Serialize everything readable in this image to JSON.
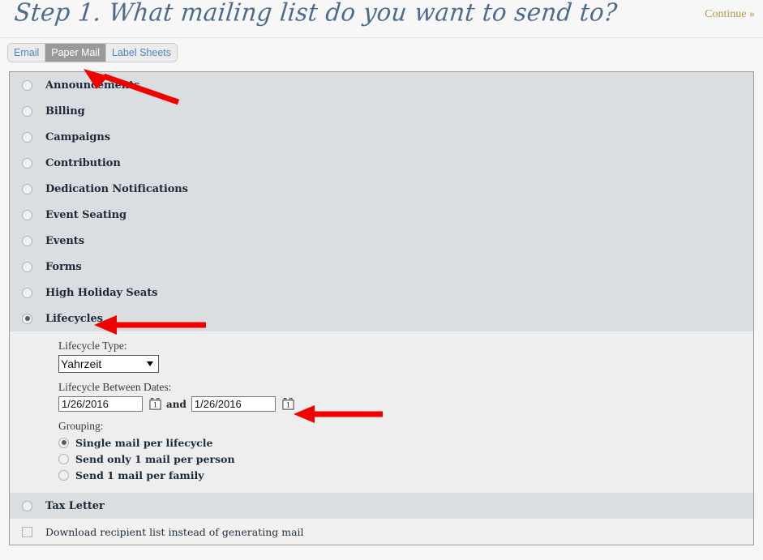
{
  "header": {
    "title": "Step 1. What mailing list do you want to send to?",
    "continue_label": "Continue »",
    "title_color": "#4d6b8f",
    "continue_color": "#b39841"
  },
  "tabs": [
    {
      "label": "Email",
      "active": false
    },
    {
      "label": "Paper Mail",
      "active": true
    },
    {
      "label": "Label Sheets",
      "active": false
    }
  ],
  "list": {
    "items": [
      {
        "label": "Announcements",
        "selected": false
      },
      {
        "label": "Billing",
        "selected": false
      },
      {
        "label": "Campaigns",
        "selected": false
      },
      {
        "label": "Contribution",
        "selected": false
      },
      {
        "label": "Dedication Notifications",
        "selected": false
      },
      {
        "label": "Event Seating",
        "selected": false
      },
      {
        "label": "Events",
        "selected": false
      },
      {
        "label": "Forms",
        "selected": false
      },
      {
        "label": "High Holiday Seats",
        "selected": false
      },
      {
        "label": "Lifecycles",
        "selected": true
      }
    ],
    "trailing_items": [
      {
        "label": "Tax Letter",
        "selected": false
      }
    ]
  },
  "lifecycle_panel": {
    "type_label": "Lifecycle Type:",
    "type_value": "Yahrzeit",
    "type_options": [
      "Yahrzeit"
    ],
    "dates_label": "Lifecycle Between Dates:",
    "date_from": "1/26/2016",
    "date_to": "1/26/2016",
    "and_text": "and",
    "calendar_icon_from": "calendar-icon",
    "calendar_icon_to": "calendar-icon",
    "grouping_label": "Grouping:",
    "grouping_options": [
      {
        "label": "Single mail per lifecycle",
        "selected": true
      },
      {
        "label": "Send only 1 mail per person",
        "selected": false
      },
      {
        "label": "Send 1 mail per family",
        "selected": false
      }
    ]
  },
  "footer": {
    "download_label": "Download recipient list instead of generating mail",
    "download_checked": false
  },
  "annotations": {
    "color": "#f20000",
    "arrows": [
      {
        "name": "arrow-to-paper-mail-tab"
      },
      {
        "name": "arrow-to-lifecycles-row"
      },
      {
        "name": "arrow-to-date-range"
      }
    ]
  },
  "colors": {
    "page_background": "#f6f6f6",
    "row_background": "#dadee1",
    "panel_background": "#eeeeee",
    "footer_background": "#f1f1f1",
    "accent_blue": "#4f83c4"
  }
}
